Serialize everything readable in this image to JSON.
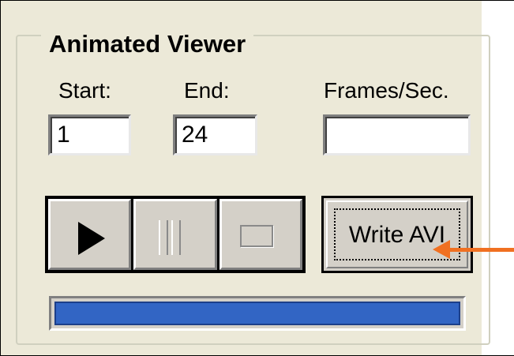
{
  "group": {
    "title": "Animated Viewer"
  },
  "fields": {
    "start": {
      "label": "Start:",
      "value": "1"
    },
    "end": {
      "label": "End:",
      "value": "24"
    },
    "fps": {
      "label": "Frames/Sec.",
      "value": ""
    }
  },
  "controls": {
    "play_icon": "play-icon",
    "pause_icon": "pause-icon",
    "stop_icon": "stop-icon",
    "write_avi_label": "Write AVI"
  },
  "progress": {
    "fraction": 1.0
  },
  "colors": {
    "panel_bg": "#ece9d8",
    "progress_fill": "#3265c4",
    "annotation_arrow": "#f07021"
  }
}
